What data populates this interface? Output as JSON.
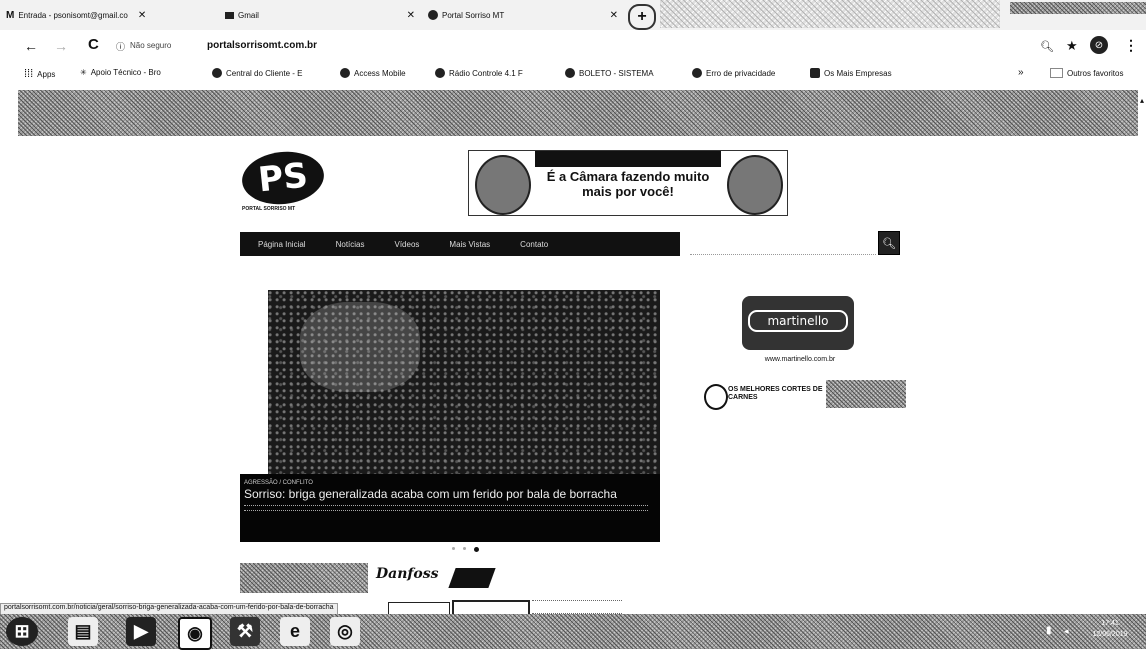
{
  "browser": {
    "tabs": [
      {
        "icon": "gmail-icon",
        "label": "Entrada - psonisomt@gmail.co"
      },
      {
        "icon": "mail-icon",
        "label": "Gmail"
      },
      {
        "icon": "globe-icon",
        "label": "Portal Sorriso MT"
      }
    ],
    "security_label": "Não seguro",
    "url": "portalsorrisomt.com.br",
    "bookmarks": [
      "Apps",
      "Apoio Técnico - Bro",
      "Central do Cliente - E",
      "Access Mobile",
      "Rádio Controle 4.1 F",
      "BOLETO - SISTEMA",
      "Erro de privacidade",
      "Os Mais Empresas"
    ],
    "other_bookmarks": "Outros favoritos",
    "status_url": "portalsorrisomt.com.br/noticia/geral/sorriso-briga-generalizada-acaba-com-um-ferido-por-bala-de-borracha"
  },
  "site": {
    "logo_text": "PS",
    "logo_subtitle": "PORTAL SORRISO MT",
    "ad_banner_main": "É a Câmara fazendo muito mais por você!",
    "nav": [
      "Página Inicial",
      "Notícias",
      "Vídeos",
      "Mais Vistas",
      "Contato"
    ],
    "headline_tag": "AGRESSÃO / CONFLITO",
    "headline": "Sorriso: briga generalizada acaba com um ferido por bala de borracha",
    "sidebar_ad1": "martinello",
    "sidebar_ad1_url": "www.martinello.com.br",
    "sidebar_ad2": "OS MELHORES CORTES DE CARNES",
    "sponsor_name": "Danfoss"
  },
  "taskbar": {
    "time": "17:41",
    "date": "12/06/2019"
  }
}
